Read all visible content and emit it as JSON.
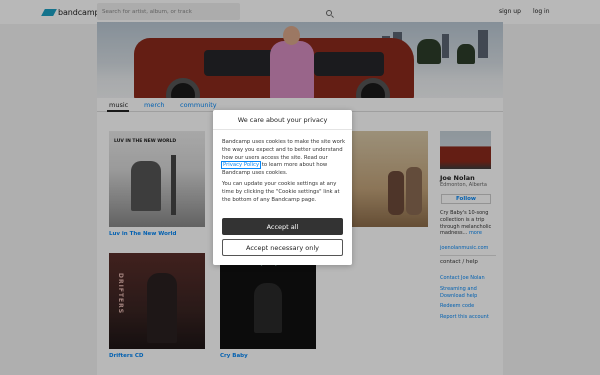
{
  "header": {
    "logo_text": "bandcamp",
    "search_placeholder": "Search for artist, album, or track",
    "signup_label": "sign up",
    "login_label": "log in"
  },
  "tabs": {
    "music": "music",
    "merch": "merch",
    "community": "community"
  },
  "albums": [
    {
      "title": "Luv in The New World",
      "cover_text": "LUV IN THE NEW WORLD"
    },
    {
      "title": "Drifters CD",
      "cover_text": "DRIFTERS"
    },
    {
      "title": "Cry Baby",
      "cover_text": "Cry Baby"
    }
  ],
  "sidebar": {
    "artist_name": "Joe Nolan",
    "location": "Edmonton, Alberta",
    "follow_label": "Follow",
    "bio": "Cry Baby's 10-song collection is a trip through melancholic madness...",
    "more_label": "more",
    "website": "joenolanmusic.com",
    "contact_heading": "contact / help",
    "links": [
      "Contact Joe Nolan",
      "Streaming and Download help",
      "Redeem code",
      "Report this account"
    ]
  },
  "cookie_dialog": {
    "title": "We care about your privacy",
    "text_before_link": "Bandcamp uses cookies to make the site work the way you expect and to better understand how our users access the site. Read our",
    "link_text": "Privacy Policy",
    "text_after_link": "to learn more about how Bandcamp uses cookies.",
    "text_2": "You can update your cookie settings at any time by clicking the \"Cookie settings\" link at the bottom of any Bandcamp page.",
    "accept_all_label": "Accept all",
    "accept_necessary_label": "Accept necessary only"
  },
  "colors": {
    "link": "#0687f5",
    "brand": "#1da0c3",
    "primary_button": "#333333"
  }
}
